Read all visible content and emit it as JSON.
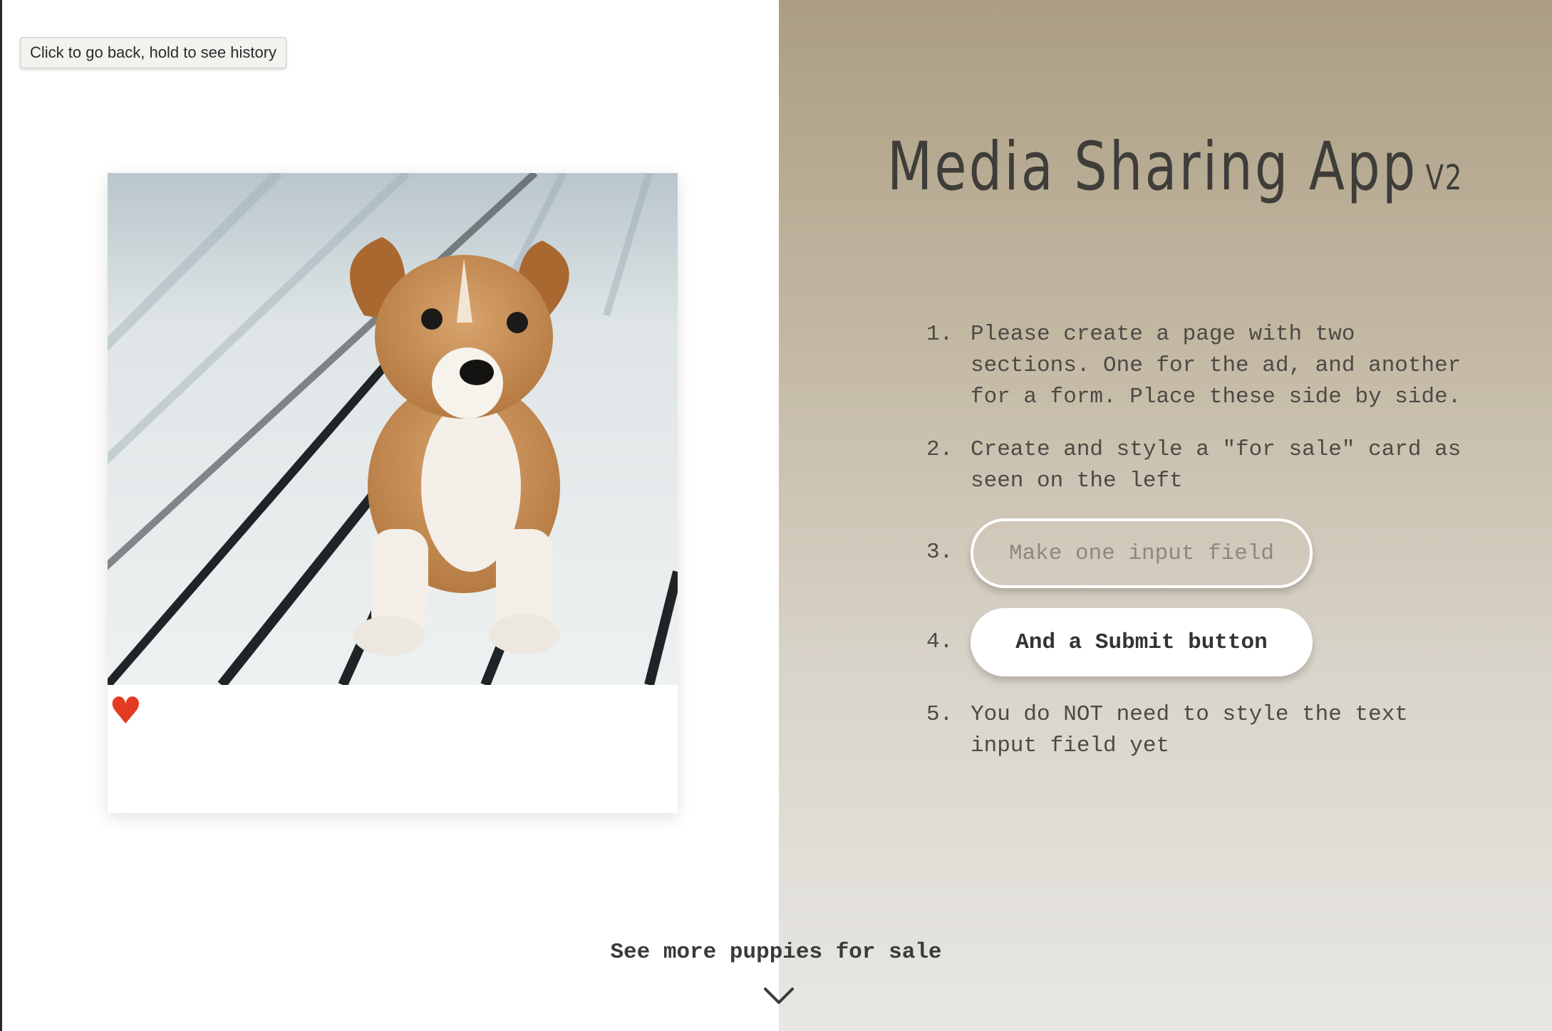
{
  "tooltip": {
    "text": "Click to go back, hold to see history"
  },
  "card": {
    "heart_glyph": "♥",
    "heart_color": "#e23b22"
  },
  "footer": {
    "see_more_label": "See more puppies for sale"
  },
  "header": {
    "title": "Media Sharing App",
    "version": "V2"
  },
  "steps": [
    {
      "number": "1.",
      "text": "Please create a page with two sections. One for the ad, and another for a form. Place these side by side."
    },
    {
      "number": "2.",
      "text": "Create and style a \"for sale\" card as seen on the left"
    },
    {
      "number": "3.",
      "input_placeholder": "Make one input field"
    },
    {
      "number": "4.",
      "button_label": "And a Submit button"
    },
    {
      "number": "5.",
      "text": "You do NOT need to style the text input field yet"
    }
  ],
  "colors": {
    "right_panel_top": "#ab9e82",
    "right_panel_bottom": "#e8e7e4",
    "heart": "#e23b22"
  }
}
